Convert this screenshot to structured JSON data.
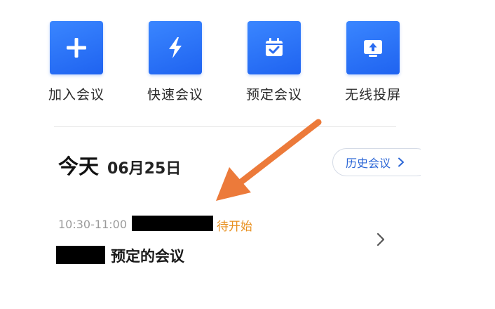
{
  "quick_actions": [
    {
      "label": "加入会议",
      "icon": "plus-icon"
    },
    {
      "label": "快速会议",
      "icon": "lightning-icon"
    },
    {
      "label": "预定会议",
      "icon": "calendar-check-icon"
    },
    {
      "label": "无线投屏",
      "icon": "screen-cast-icon"
    }
  ],
  "today": {
    "title": "今天",
    "date": "06月25日"
  },
  "history_button": {
    "label": "历史会议"
  },
  "meeting": {
    "time": "10:30-11:00",
    "status": "待开始",
    "title": "预定的会议"
  },
  "colors": {
    "accent": "#2b6cf2",
    "status": "#e8901f",
    "annotation_arrow": "#ec7a3a"
  }
}
